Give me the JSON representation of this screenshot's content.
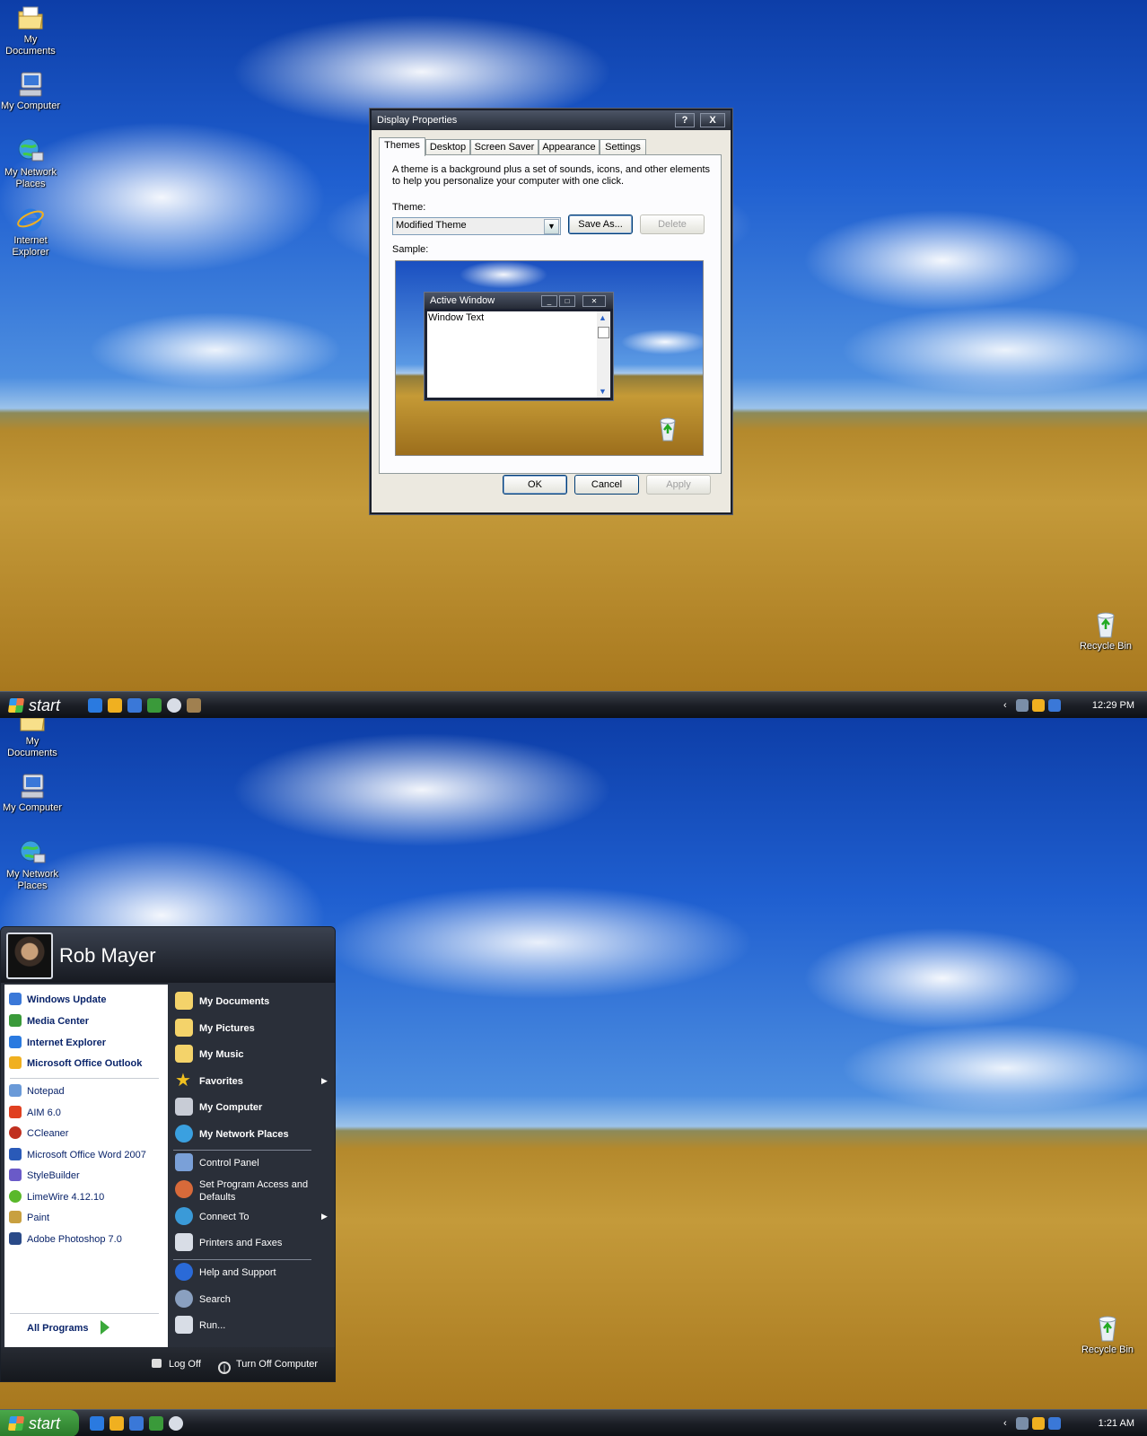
{
  "desktop_icons": [
    {
      "label_line1": "My",
      "label_line2": "Documents",
      "icon": "my-documents-icon"
    },
    {
      "label_line1": "My Computer",
      "label_line2": "",
      "icon": "my-computer-icon"
    },
    {
      "label_line1": "My Network",
      "label_line2": "Places",
      "icon": "network-places-icon"
    },
    {
      "label_line1": "Internet",
      "label_line2": "Explorer",
      "icon": "internet-explorer-icon"
    }
  ],
  "recycle_bin": {
    "label": "Recycle Bin"
  },
  "taskbar": {
    "start_label": "start",
    "clock_top": "12:29 PM",
    "clock_bottom": "1:21 AM"
  },
  "dialog": {
    "title": "Display Properties",
    "help_btn": "?",
    "close_btn": "X",
    "tabs": [
      "Themes",
      "Desktop",
      "Screen Saver",
      "Appearance",
      "Settings"
    ],
    "description": "A theme is a background plus a set of sounds, icons, and other elements to help you personalize your computer with one click.",
    "theme_label": "Theme:",
    "theme_value": "Modified Theme",
    "save_as": "Save As...",
    "delete": "Delete",
    "sample_label": "Sample:",
    "sample_window_title": "Active Window",
    "sample_window_text": "Window Text",
    "ok": "OK",
    "cancel": "Cancel",
    "apply": "Apply"
  },
  "start_menu": {
    "user": "Rob Mayer",
    "pinned": [
      "Windows Update",
      "Media Center",
      "Internet Explorer",
      "Microsoft Office Outlook"
    ],
    "recent": [
      "Notepad",
      "AIM 6.0",
      "CCleaner",
      "Microsoft Office Word 2007",
      "StyleBuilder",
      "LimeWire 4.12.10",
      "Paint",
      "Adobe Photoshop 7.0"
    ],
    "all_programs": "All Programs",
    "right_group1": [
      "My Documents",
      "My Pictures",
      "My Music",
      "Favorites",
      "My Computer",
      "My Network Places"
    ],
    "right_group2": [
      "Control Panel",
      "Set Program Access and Defaults",
      "Connect To",
      "Printers and Faxes"
    ],
    "right_group3": [
      "Help and Support",
      "Search",
      "Run..."
    ],
    "log_off": "Log Off",
    "turn_off": "Turn Off Computer"
  },
  "colors": {
    "taskbar": "#1c1f26",
    "menu_dark": "#2a2f39",
    "link": "#0a246a"
  }
}
